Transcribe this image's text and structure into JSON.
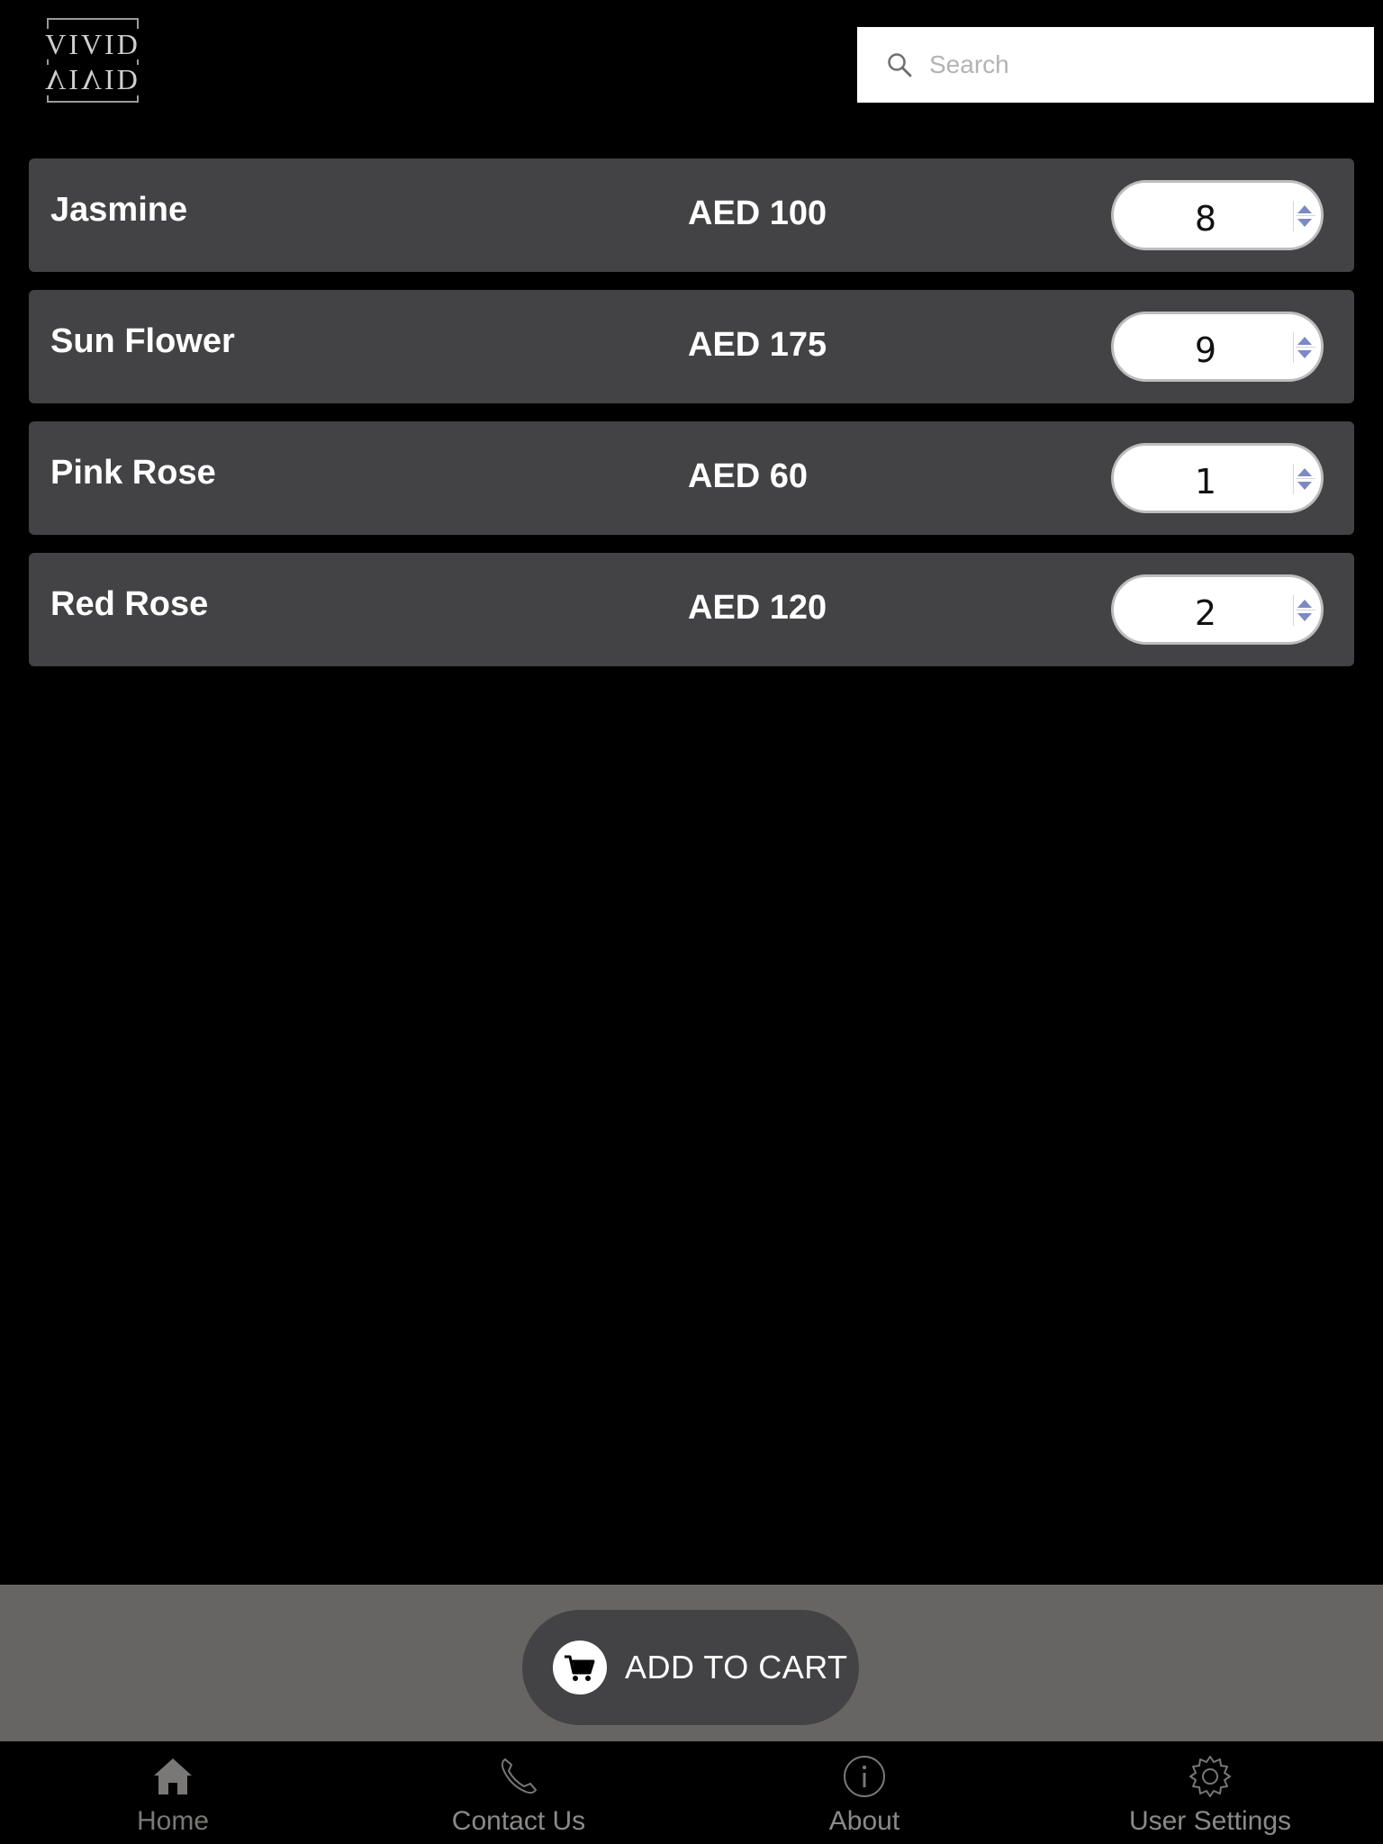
{
  "header": {
    "logo_text": "VIVID",
    "search": {
      "placeholder": "Search",
      "value": ""
    }
  },
  "products": [
    {
      "name": "Jasmine",
      "price": "AED 100",
      "quantity": "8"
    },
    {
      "name": "Sun Flower",
      "price": "AED 175",
      "quantity": "9"
    },
    {
      "name": "Pink Rose",
      "price": "AED 60",
      "quantity": "1"
    },
    {
      "name": "Red Rose",
      "price": "AED 120",
      "quantity": "2"
    }
  ],
  "cart_button": {
    "label": "ADD TO CART",
    "icon": "cart-icon"
  },
  "tabs": [
    {
      "label": "Home",
      "icon": "home-icon"
    },
    {
      "label": "Contact Us",
      "icon": "phone-icon"
    },
    {
      "label": "About",
      "icon": "info-icon"
    },
    {
      "label": "User Settings",
      "icon": "gear-icon"
    }
  ],
  "colors": {
    "background": "#000000",
    "row": "#434345",
    "bottom_bar": "#676564",
    "tab_label": "#8c8a88"
  }
}
